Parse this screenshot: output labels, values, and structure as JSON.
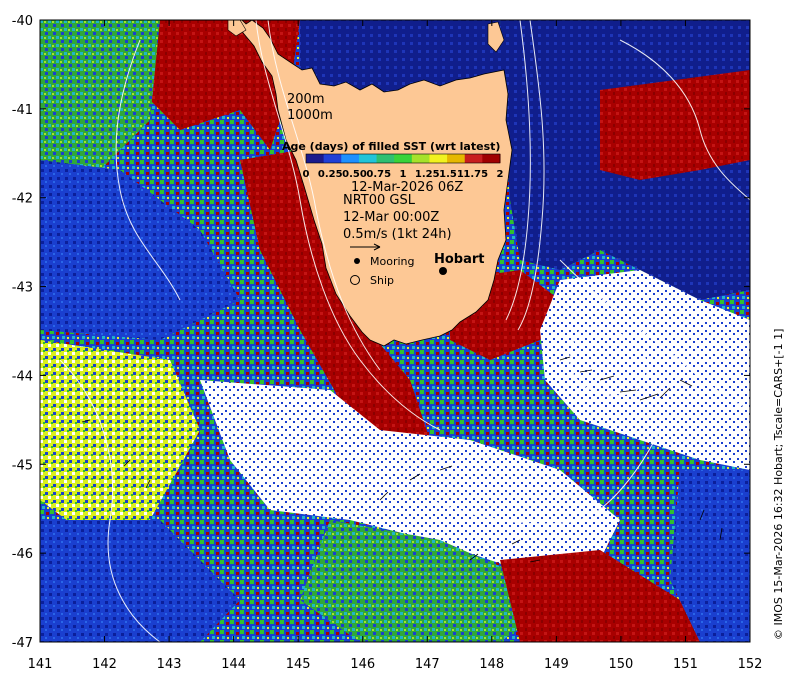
{
  "map": {
    "lon_range": [
      141,
      152
    ],
    "lat_range": [
      -47,
      -40
    ],
    "x_ticks": [
      "141",
      "142",
      "143",
      "144",
      "145",
      "146",
      "147",
      "148",
      "149",
      "150",
      "151",
      "152"
    ],
    "y_ticks": [
      "-40",
      "-41",
      "-42",
      "-43",
      "-44",
      "-45",
      "-46",
      "-47"
    ]
  },
  "isobaths": {
    "label_200": "200m",
    "label_1000": "1000m"
  },
  "colorbar": {
    "title": "Age (days) of filled SST (wrt latest)",
    "ticks": [
      "0",
      "0.25",
      "0.50",
      "0.75",
      "1",
      "1.25",
      "1.51",
      "1.75",
      "2"
    ],
    "colors": [
      "#1a1a8c",
      "#1f3fd6",
      "#1e90ff",
      "#22c4d8",
      "#2fbf71",
      "#39d33a",
      "#a6e22a",
      "#f2f21f",
      "#e6b800",
      "#c81e1e",
      "#a00000"
    ]
  },
  "info": {
    "datetime": "12-Mar-2026 06Z",
    "product": "NRT00 GSL",
    "current_time": "12-Mar 00:00Z",
    "arrow_scale": "0.5m/s (1kt 24h)"
  },
  "legend": {
    "mooring": "Mooring",
    "ship": "Ship"
  },
  "places": {
    "hobart": "Hobart"
  },
  "credit": "© IMOS 15-Mar-2026 16:32 Hobart; Tscale=CARS+[-1 1]",
  "colors": {
    "land": "#fdc895",
    "deep_blue": "#0b1f9a",
    "dark_red": "#a80000",
    "green": "#2fbf2f",
    "cyan": "#1fb6c8",
    "yellow": "#e8f51f"
  }
}
